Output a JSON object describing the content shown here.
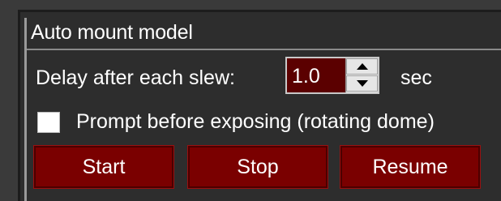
{
  "group": {
    "title": "Auto mount model"
  },
  "delay": {
    "label": "Delay after each slew:",
    "value": "1.0",
    "unit": "sec"
  },
  "prompt": {
    "label": "Prompt before exposing (rotating dome)",
    "checked": false
  },
  "buttons": {
    "start": "Start",
    "stop": "Stop",
    "resume": "Resume"
  },
  "colors": {
    "background": "#2d2d2d",
    "button": "#7a0000",
    "spin_field": "#5b0000",
    "text": "#ffffff"
  }
}
